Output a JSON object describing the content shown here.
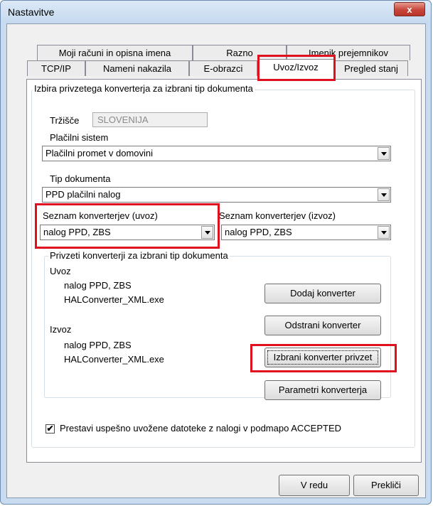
{
  "window": {
    "title": "Nastavitve",
    "close_label": "x"
  },
  "tabs_row1": [
    "Moji računi in opisna imena",
    "Razno",
    "Imenik prejemnikov"
  ],
  "tabs_row2": [
    "TCP/IP",
    "Nameni nakazila",
    "E-obrazci",
    "Uvoz/Izvoz",
    "Pregled stanj"
  ],
  "active_tab": "Uvoz/Izvoz",
  "group_main": {
    "title": "Izbira privzetega konverterja za izbrani tip dokumenta"
  },
  "market": {
    "label": "Tržišče",
    "value": "SLOVENIJA"
  },
  "payment_system": {
    "label": "Plačilni sistem",
    "value": "Plačilni promet v domovini"
  },
  "doc_type": {
    "label": "Tip dokumenta",
    "value": "PPD plačilni nalog"
  },
  "import_list": {
    "label": "Seznam konverterjev (uvoz)",
    "value": "nalog PPD, ZBS"
  },
  "export_list": {
    "label": "Seznam konverterjev (izvoz)",
    "value": "nalog PPD, ZBS"
  },
  "group_default": {
    "title": "Privzeti konverterji za izbrani tip dokumenta",
    "import_heading": "Uvoz",
    "import_lines": [
      "nalog PPD, ZBS",
      "HALConverter_XML.exe"
    ],
    "export_heading": "Izvoz",
    "export_lines": [
      "nalog PPD, ZBS",
      "HALConverter_XML.exe"
    ]
  },
  "buttons": {
    "add": "Dodaj konverter",
    "remove": "Odstrani konverter",
    "select_default": "Izbrani konverter privzet",
    "params": "Parametri konverterja",
    "ok": "V redu",
    "cancel": "Prekliči"
  },
  "checkbox": {
    "label": "Prestavi uspešno uvožene datoteke z nalogi v podmapo ACCEPTED",
    "checked": true,
    "mark": "✔"
  },
  "colors": {
    "highlight": "#e0101e",
    "close_button": "#c7453a"
  }
}
